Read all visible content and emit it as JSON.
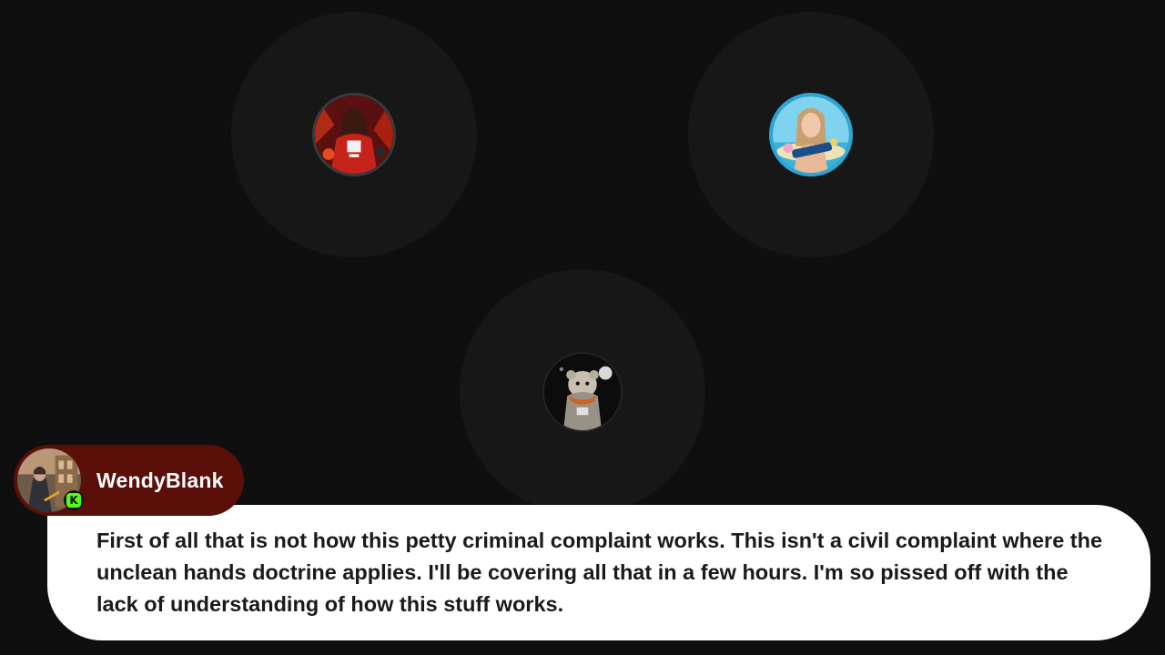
{
  "participants": [
    {
      "id": "participant-1",
      "avatar_icon": "avatar-red-character-icon",
      "border_color": "#3a3a3a"
    },
    {
      "id": "participant-2",
      "avatar_icon": "avatar-nonsense-woman-icon",
      "border_color": "#2aa6d6"
    },
    {
      "id": "participant-3",
      "avatar_icon": "avatar-ewok-icon",
      "border_color": "#222222"
    }
  ],
  "speaker": {
    "name": "WendyBlank",
    "badge_icon": "kick-badge-icon",
    "badge_letter": "K",
    "tag_color": "#5a0f08",
    "badge_color": "#53fc18"
  },
  "message": {
    "text": "First of all that is not how this petty criminal complaint works. This isn't a civil complaint where the unclean hands doctrine applies. I'll be covering all that in a few hours. I'm so pissed off with the lack of understanding of how this stuff works."
  },
  "colors": {
    "background": "#0f0f0f",
    "halo": "#171717",
    "bubble": "#ffffff"
  }
}
